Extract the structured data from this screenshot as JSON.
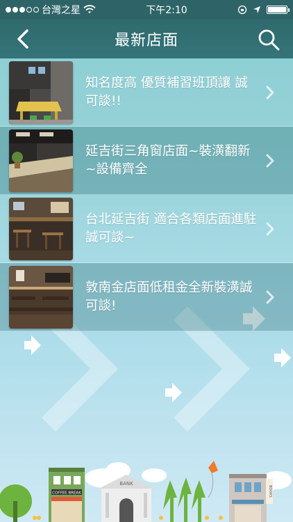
{
  "status": {
    "carrier": "台灣之星",
    "time": "下午2:10",
    "battery_level": 1.0
  },
  "nav": {
    "title": "最新店面",
    "back_icon": "chevron-left-icon",
    "search_icon": "search-icon"
  },
  "listings": [
    {
      "title": "知名度高 優質補習班頂讓 誠可談!!",
      "thumb": "classroom-photo",
      "chevron": "chevron-right-icon"
    },
    {
      "title": "延吉街三角窗店面~裝潢翻新~設備齊全",
      "thumb": "bar-counter-photo",
      "chevron": "chevron-right-icon"
    },
    {
      "title": "台北延吉街 適合各類店面進駐 誠可談~",
      "thumb": "restaurant-photo",
      "chevron": "chevron-right-icon"
    },
    {
      "title": "敦南金店面低租金全新裝潢誠可談!",
      "thumb": "dining-room-photo",
      "chevron": "chevron-right-icon"
    }
  ],
  "illustration": {
    "coffee_sign": "COFFEE BREAK",
    "bank_sign": "BANK",
    "books_sign": "BOOKS"
  },
  "colors": {
    "navbar": "#2f6a6e",
    "row_alt": "#3c787d",
    "background_top": "#7fc9cf",
    "background_bottom": "#cfe9f4"
  }
}
